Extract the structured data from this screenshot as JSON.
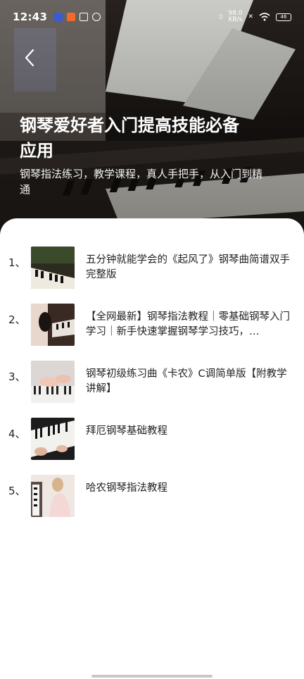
{
  "status_bar": {
    "time": "12:43",
    "speed_value": "98.0",
    "speed_unit": "KB/s",
    "battery": "46",
    "icons": [
      "play-icon",
      "app-icon",
      "box-icon",
      "link-icon",
      "vibrate-icon",
      "x-icon",
      "wifi-icon",
      "battery-icon"
    ]
  },
  "header": {
    "back_icon": "chevron-left-icon",
    "title": "钢琴爱好者入门提高技能必备应用",
    "subtitle": "钢琴指法练习，教学课程，真人手把手，从入门到精通"
  },
  "list": {
    "items": [
      {
        "index": "1、",
        "title": "五分钟就能学会的《起风了》钢琴曲简谱双手完整版"
      },
      {
        "index": "2、",
        "title": "【全网最新】钢琴指法教程｜零基础钢琴入门学习｜新手快速掌握钢琴学习技巧，…"
      },
      {
        "index": "3、",
        "title": "钢琴初级练习曲《卡农》C调简单版【附教学讲解】"
      },
      {
        "index": "4、",
        "title": "拜厄钢琴基础教程"
      },
      {
        "index": "5、",
        "title": "哈农钢琴指法教程"
      }
    ]
  }
}
